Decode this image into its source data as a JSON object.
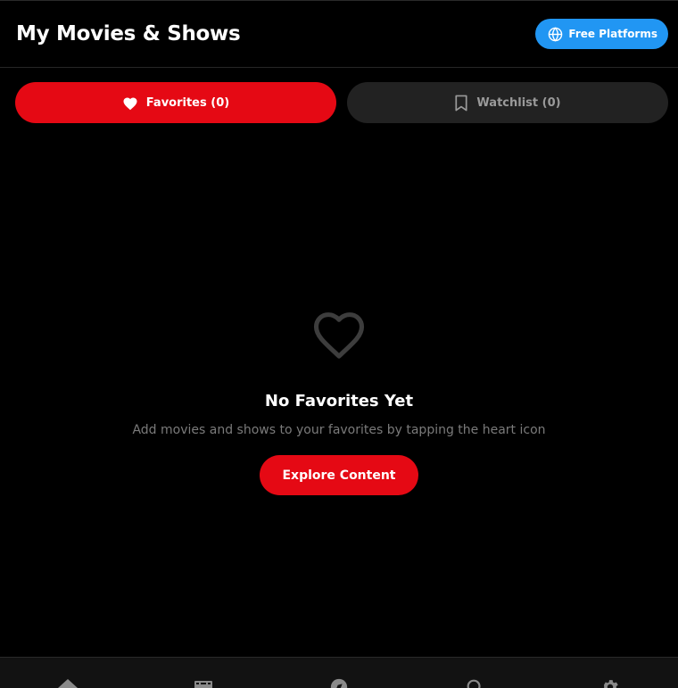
{
  "header": {
    "title": "My Movies & Shows",
    "free_platforms_label": "Free Platforms",
    "free_platforms_icon": "globe-icon"
  },
  "tabs": [
    {
      "label": "Favorites (0)",
      "icon": "heart-icon",
      "active": true
    },
    {
      "label": "Watchlist (0)",
      "icon": "bookmark-icon",
      "active": false
    }
  ],
  "empty_state": {
    "icon": "heart-outline-icon",
    "title": "No Favorites Yet",
    "subtitle": "Add movies and shows to your favorites by tapping the heart icon",
    "button_label": "Explore Content"
  },
  "bottom_nav": [
    {
      "icon": "home-icon"
    },
    {
      "icon": "film-icon"
    },
    {
      "icon": "compass-icon"
    },
    {
      "icon": "search-icon"
    },
    {
      "icon": "gear-icon"
    }
  ],
  "colors": {
    "accent": "#e50914",
    "blue": "#2196f3",
    "background": "#000000",
    "tab_inactive_bg": "#222222"
  }
}
